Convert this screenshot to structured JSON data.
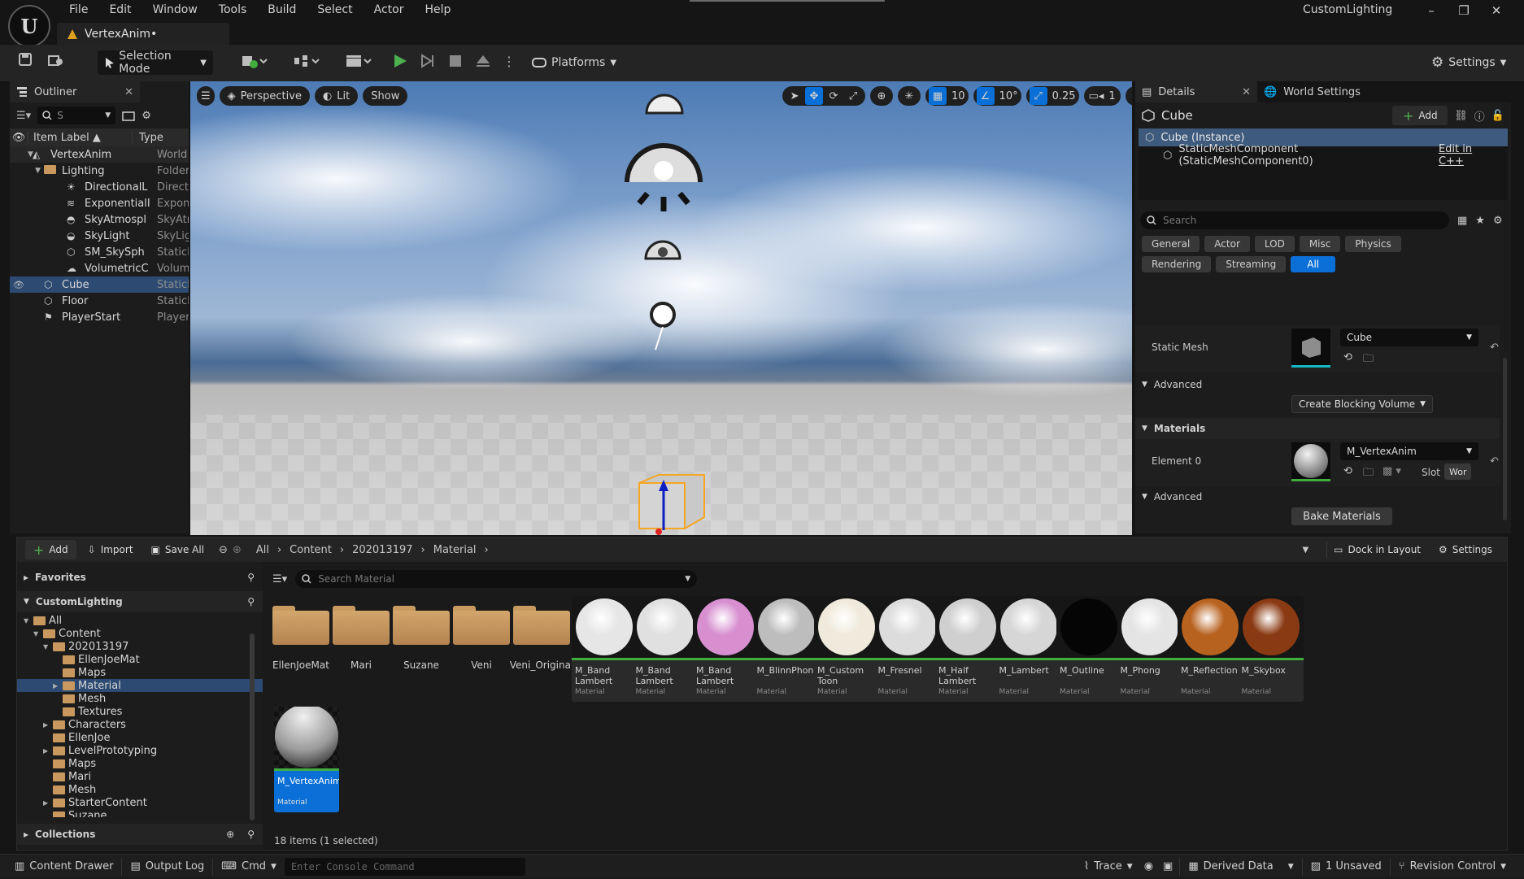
{
  "app": {
    "project_name": "CustomLighting",
    "logo_letter": "U",
    "menu": [
      "File",
      "Edit",
      "Window",
      "Tools",
      "Build",
      "Select",
      "Actor",
      "Help"
    ],
    "document_tab": "VertexAnim•",
    "window_controls": [
      "–",
      "❐",
      "✕"
    ]
  },
  "toolbar": {
    "selection_mode": "Selection Mode",
    "platforms": "Platforms",
    "settings": "Settings"
  },
  "outliner": {
    "tab": "Outliner",
    "search_value": "S",
    "columns": [
      "Item Label",
      "Type"
    ],
    "rows": [
      {
        "label": "VertexAnim (Edit",
        "type": "World",
        "depth": 0,
        "icon": "level-icon"
      },
      {
        "label": "Lighting",
        "type": "Folder",
        "depth": 1,
        "icon": "folder-icon"
      },
      {
        "label": "DirectionalL",
        "type": "Directio",
        "depth": 2,
        "icon": "directional-light-icon"
      },
      {
        "label": "ExponentialI",
        "type": "Exponer",
        "depth": 2,
        "icon": "fog-icon"
      },
      {
        "label": "SkyAtmospl",
        "type": "SkyAtmc",
        "depth": 2,
        "icon": "sky-atmosphere-icon"
      },
      {
        "label": "SkyLight",
        "type": "SkyLigh",
        "depth": 2,
        "icon": "sky-light-icon"
      },
      {
        "label": "SM_SkySph",
        "type": "StaticMe",
        "depth": 2,
        "icon": "static-mesh-icon"
      },
      {
        "label": "VolumetricC",
        "type": "Volumet",
        "depth": 2,
        "icon": "cloud-icon"
      },
      {
        "label": "Cube",
        "type": "StaticMe",
        "depth": 1,
        "icon": "static-mesh-icon"
      },
      {
        "label": "Floor",
        "type": "StaticMe",
        "depth": 1,
        "icon": "static-mesh-icon"
      },
      {
        "label": "PlayerStart",
        "type": "PlayerSt",
        "depth": 1,
        "icon": "player-start-icon"
      }
    ]
  },
  "viewport": {
    "perspective": "Perspective",
    "lit": "Lit",
    "show": "Show",
    "grid_snap": "10",
    "rotation_snap": "10°",
    "scale_snap": "0.25",
    "camera_speed": "1"
  },
  "details": {
    "tab": "Details",
    "world_settings_tab": "World Settings",
    "actor_name": "Cube",
    "add": "Add",
    "instance": "Cube (Instance)",
    "component": "StaticMeshComponent (StaticMeshComponent0)",
    "edit_cpp": "Edit in C++",
    "search_placeholder": "Search",
    "categories": [
      "General",
      "Actor",
      "LOD",
      "Misc",
      "Physics",
      "Rendering",
      "Streaming",
      "All"
    ],
    "static_mesh_label": "Static Mesh",
    "static_mesh_value": "Cube",
    "advanced": "Advanced",
    "create_blocking_volume": "Create Blocking Volume",
    "materials": "Materials",
    "element0_label": "Element 0",
    "element0_value": "M_VertexAnim",
    "slot": "Slot",
    "slot_value": "Wor",
    "advanced2": "Advanced",
    "bake_materials": "Bake Materials"
  },
  "content_browser": {
    "add": "Add",
    "import": "Import",
    "save_all": "Save All",
    "breadcrumb": [
      "All",
      "Content",
      "202013197",
      "Material"
    ],
    "dock_in_layout": "Dock in Layout",
    "settings": "Settings",
    "favorites": "Favorites",
    "project": "CustomLighting",
    "collections": "Collections",
    "search_placeholder": "Search Material",
    "status": "18 items (1 selected)",
    "tree": [
      {
        "label": "All",
        "depth": 0
      },
      {
        "label": "Content",
        "depth": 1
      },
      {
        "label": "202013197",
        "depth": 2
      },
      {
        "label": "EllenJoeMat",
        "depth": 3
      },
      {
        "label": "Maps",
        "depth": 3
      },
      {
        "label": "Material",
        "depth": 3
      },
      {
        "label": "Mesh",
        "depth": 3
      },
      {
        "label": "Textures",
        "depth": 3
      },
      {
        "label": "Characters",
        "depth": 2
      },
      {
        "label": "EllenJoe",
        "depth": 2
      },
      {
        "label": "LevelPrototyping",
        "depth": 2
      },
      {
        "label": "Maps",
        "depth": 2
      },
      {
        "label": "Mari",
        "depth": 2
      },
      {
        "label": "Mesh",
        "depth": 2
      },
      {
        "label": "StarterContent",
        "depth": 2
      },
      {
        "label": "Suzane",
        "depth": 2
      }
    ],
    "folders": [
      "EllenJoeMat",
      "Mari",
      "Suzane",
      "Veni",
      "Veni_Original"
    ],
    "materials": [
      {
        "name": "M_Band Lambert",
        "kind": "Material",
        "color": "#e6e6e6"
      },
      {
        "name": "M_Band Lambert Outline",
        "kind": "Material",
        "color": "#e0e0e0"
      },
      {
        "name": "M_Band Lambert Outline",
        "kind": "Material",
        "color": "#d78fd0"
      },
      {
        "name": "M_BlinnPhong",
        "kind": "Material",
        "color": "#bdbdbd"
      },
      {
        "name": "M_Custom Toon",
        "kind": "Material",
        "color": "#efeadb"
      },
      {
        "name": "M_Fresnel",
        "kind": "Material",
        "color": "#dcdcdc"
      },
      {
        "name": "M_Half Lambert",
        "kind": "Material",
        "color": "#cfcfcf"
      },
      {
        "name": "M_Lambert",
        "kind": "Material",
        "color": "#d6d6d6"
      },
      {
        "name": "M_Outline",
        "kind": "Material",
        "color": "#050505"
      },
      {
        "name": "M_Phong",
        "kind": "Material",
        "color": "#e4e4e4"
      },
      {
        "name": "M_Reflection",
        "kind": "Material",
        "color": "#b8621f"
      },
      {
        "name": "M_Skybox",
        "kind": "Material",
        "color": "#8a3a12"
      }
    ],
    "selected_asset": {
      "name": "M_VertexAnim",
      "kind": "Material"
    }
  },
  "statusbar": {
    "content_drawer": "Content Drawer",
    "output_log": "Output Log",
    "cmd": "Cmd",
    "console_placeholder": "Enter Console Command",
    "trace": "Trace",
    "derived_data": "Derived Data",
    "unsaved": "1 Unsaved",
    "revision_control": "Revision Control"
  },
  "colors": {
    "accent": "#0a6fd6",
    "selection": "#2c4a72",
    "play": "#4caf50",
    "asset_bar": "#3fae3c"
  }
}
